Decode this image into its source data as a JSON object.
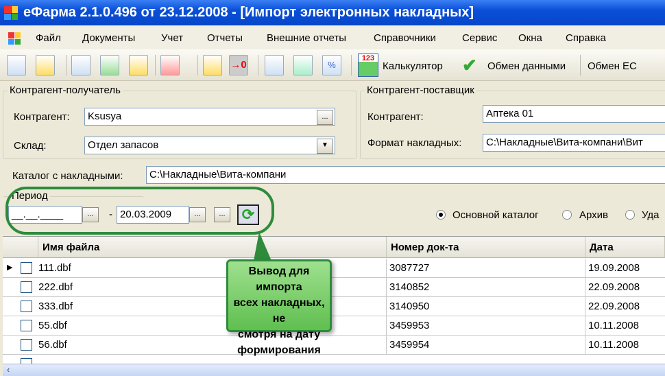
{
  "window": {
    "title": "еФарма 2.1.0.496 от 23.12.2008 - [Импорт электронных накладных]"
  },
  "menu": [
    "Файл",
    "Документы",
    "Учет",
    "Отчеты",
    "Внешние отчеты",
    "Справочники",
    "Сервис",
    "Окна",
    "Справка"
  ],
  "toolbar": {
    "calculator": "Калькулятор",
    "exchange": "Обмен данными",
    "exchange_ec": "Обмен ЕС"
  },
  "recipient": {
    "legend": "Контрагент-получатель",
    "contractor_label": "Контрагент:",
    "contractor_value": "Ksusya",
    "warehouse_label": "Склад:",
    "warehouse_value": "Отдел запасов"
  },
  "supplier": {
    "legend": "Контрагент-поставщик",
    "contractor_label": "Контрагент:",
    "contractor_value": "Аптека 01",
    "format_label": "Формат накладных:",
    "format_value": "C:\\Накладные\\Вита-компани\\Вит"
  },
  "catalog": {
    "label": "Каталог с накладными:",
    "value": "C:\\Накладные\\Вита-компани"
  },
  "period": {
    "legend": "Период",
    "from": "__.__.____",
    "dash": "-",
    "to": "20.03.2009",
    "ellipsis": "..."
  },
  "radios": [
    {
      "label": "Основной каталог",
      "checked": true
    },
    {
      "label": "Архив",
      "checked": false
    },
    {
      "label": "Уда",
      "checked": false
    }
  ],
  "grid": {
    "columns": [
      "Имя файла",
      "Номер док-та",
      "Дата"
    ],
    "rows": [
      [
        "111.dbf",
        "3087727",
        "19.09.2008"
      ],
      [
        "222.dbf",
        "3140852",
        "22.09.2008"
      ],
      [
        "333.dbf",
        "3140950",
        "22.09.2008"
      ],
      [
        "55.dbf",
        "3459953",
        "10.11.2008"
      ],
      [
        "56.dbf",
        "3459954",
        "10.11.2008"
      ]
    ]
  },
  "callout": {
    "lines": [
      "Вывод для импорта",
      "всех накладных, не",
      "смотря на дату",
      "формирования"
    ]
  },
  "colors": {
    "titlebar": "#0a4fd8",
    "annotation": "#2e8b3c",
    "callout_fill": "#7fd06f"
  }
}
